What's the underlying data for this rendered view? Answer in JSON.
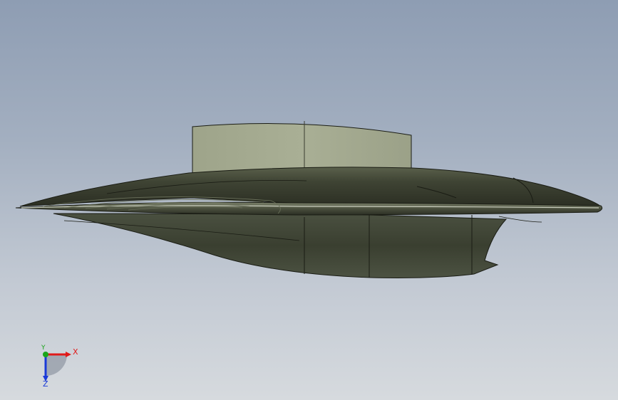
{
  "viewport": {
    "background_top": "#8e9db3",
    "background_bottom": "#d6dade"
  },
  "model": {
    "hull_color": "#3c4132",
    "canopy_color": "#a5ab90",
    "edge_color": "#1a1c14"
  },
  "triad": {
    "x_label": "X",
    "y_label": "Y",
    "z_label": "Z",
    "x_color": "#e01a1a",
    "y_color": "#1aa51a",
    "z_color": "#1a3ad8"
  }
}
